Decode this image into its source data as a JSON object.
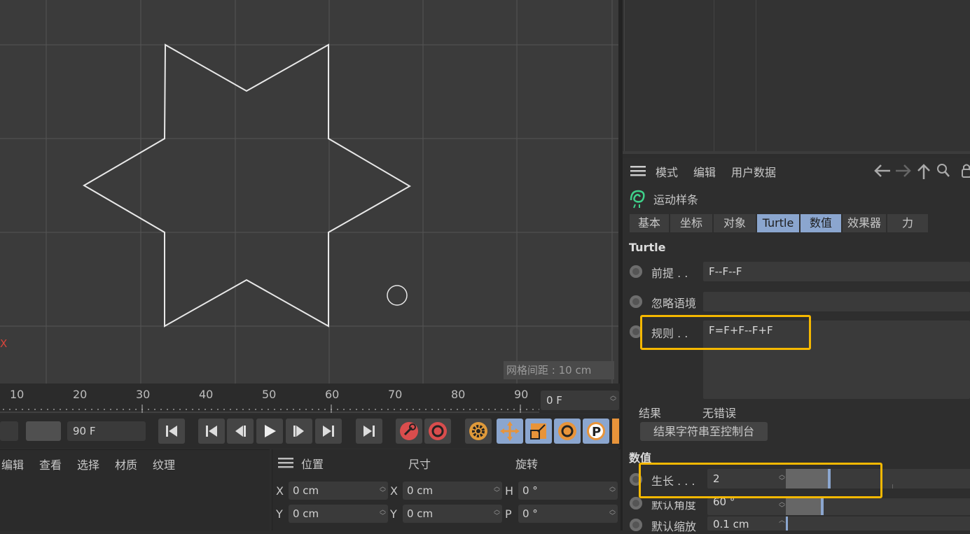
{
  "viewport": {
    "axis_letter": "X",
    "grid_spacing_label": "网格间距 : 10 cm"
  },
  "timeline": {
    "ticks": [
      "10",
      "20",
      "30",
      "40",
      "50",
      "60",
      "70",
      "80",
      "90"
    ],
    "current_frame": "0 F",
    "end_frame": "90 F"
  },
  "material_menu": [
    "编辑",
    "查看",
    "选择",
    "材质",
    "纹理"
  ],
  "coords": {
    "headers": [
      "位置",
      "尺寸",
      "旋转"
    ],
    "rows": [
      {
        "l1": "X",
        "v1": "0 cm",
        "l2": "X",
        "v2": "0 cm",
        "l3": "H",
        "v3": "0 °"
      },
      {
        "l1": "Y",
        "v1": "0 cm",
        "l2": "Y",
        "v2": "0 cm",
        "l3": "P",
        "v3": "0 °"
      }
    ]
  },
  "attr": {
    "menu": [
      "模式",
      "编辑",
      "用户数据"
    ],
    "object_name": "运动样条",
    "tabs": [
      "基本",
      "坐标",
      "对象",
      "Turtle",
      "数值",
      "效果器",
      "力"
    ],
    "section_turtle": "Turtle",
    "premise_label": "前提 . .",
    "premise_value": "F--F--F",
    "ignore_label": "忽略语境",
    "ignore_value": "",
    "rules_label": "规则 . .",
    "rules_value": "F=F+F--F+F",
    "result_label": "结果",
    "result_value": "无错误",
    "result_button": "结果字符串至控制台",
    "section_values": "数值",
    "growth_label": "生长 . . .",
    "growth_value": "2",
    "angle_label": "默认角度",
    "angle_value": "60 °",
    "scale_label": "默认缩放",
    "scale_value": "0.1 cm"
  },
  "colors": {
    "accent": "#8ba6cf",
    "highlight": "#f5b800",
    "axis_red": "#d9453b"
  }
}
